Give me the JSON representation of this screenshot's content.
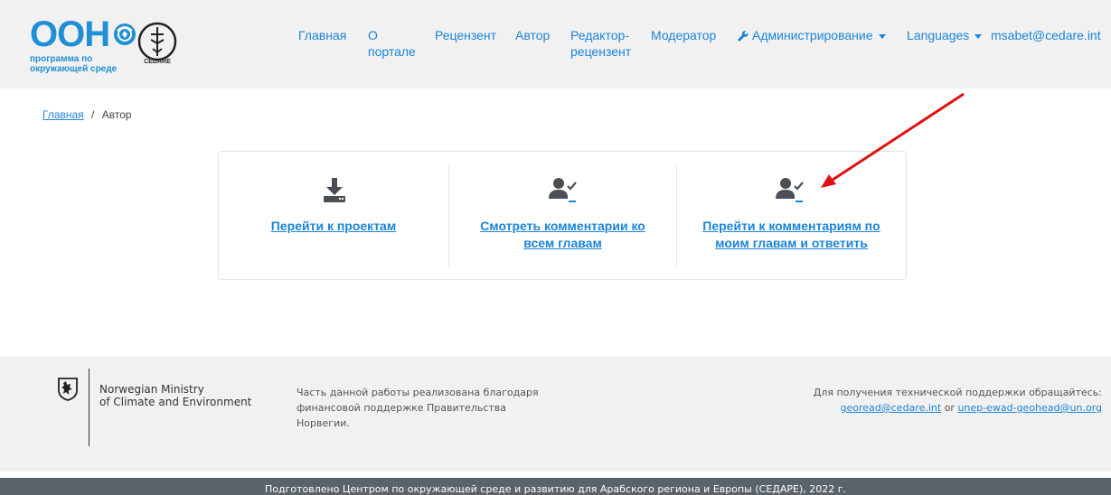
{
  "logo": {
    "title": "ООН",
    "subtitle_line1": "программа по",
    "subtitle_line2": "окружающей среде",
    "cedare_text": "CEDARE"
  },
  "nav": {
    "items": [
      "Главная",
      "О портале",
      "Рецензент",
      "Автор",
      "Редактор-рецензент",
      "Модератор"
    ],
    "item_lines": {
      "about_1": "О",
      "about_2": "порталe",
      "editor_1": "Редактор-",
      "editor_2": "рецензент"
    },
    "admin": "Администрирование",
    "languages": "Languages",
    "user": "msabet@cedare.int"
  },
  "breadcrumb": {
    "home": "Главная",
    "sep": "/",
    "current": "Автор"
  },
  "cards": [
    {
      "icon": "download-icon",
      "line1": "Перейти к проектам",
      "line2": ""
    },
    {
      "icon": "user-check-icon",
      "line1": "Смотреть комментарии ко",
      "line2": "всем главам"
    },
    {
      "icon": "user-check-icon",
      "line1": "Перейти к комментариям по",
      "line2": "моим главам и ответить"
    }
  ],
  "footer": {
    "ministry_line1": "Norwegian Ministry",
    "ministry_line2": "of Climate and Environment",
    "mid_line1": "Часть данной работы реализована благодаря",
    "mid_line2": "финансовой поддержке Правительства",
    "mid_line3": "Норвегии.",
    "support_text": "Для получения технической поддержки обращайтесь:",
    "email1": "georead@cedare.int",
    "or": "or",
    "email2": "unep-ewad-geohead@un.org",
    "bottom": "Подготовлено Центром по окружающей среде и развитию для Арабского региона и Европы (СЕДАРЕ), 2022 г."
  },
  "colors": {
    "link": "#1b84d8",
    "annotation_arrow": "#e01010",
    "icon": "#4a4f55"
  }
}
